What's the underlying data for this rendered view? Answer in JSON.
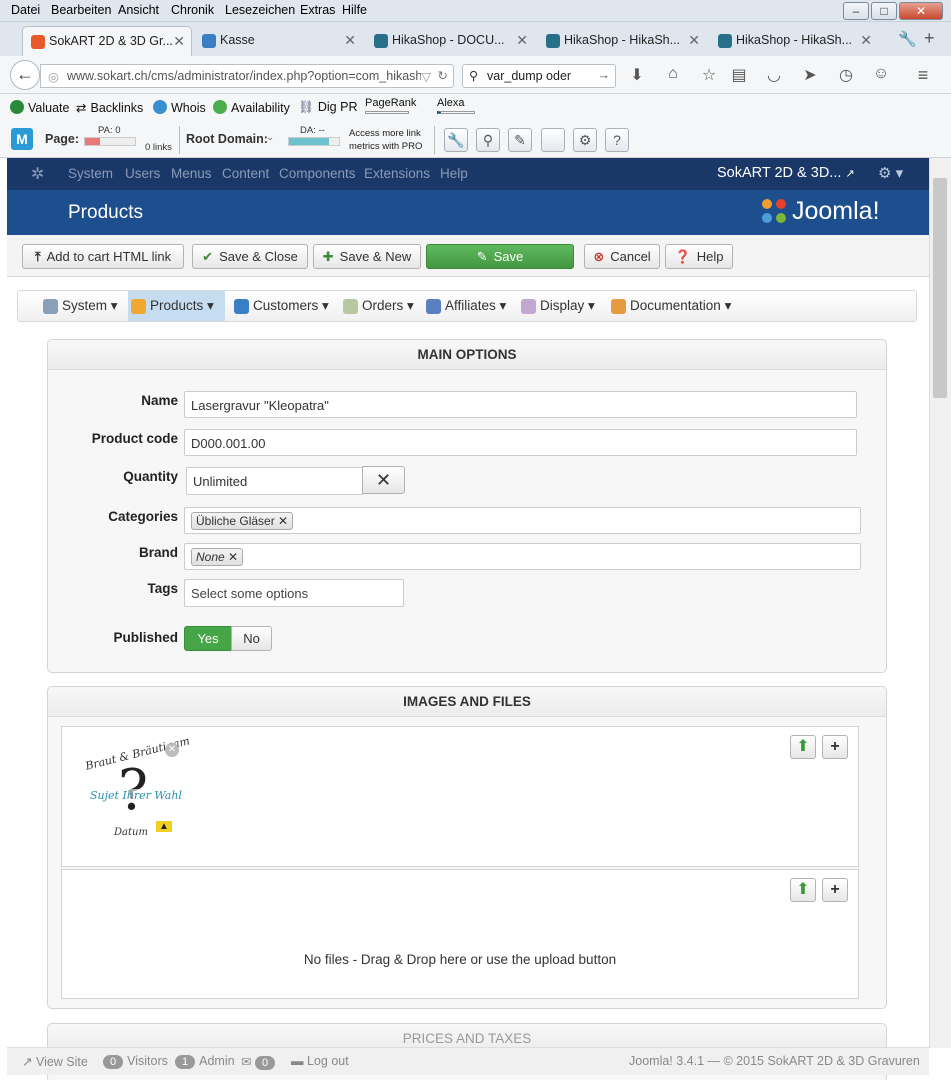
{
  "menubar": {
    "items": [
      "Datei",
      "Bearbeiten",
      "Ansicht",
      "Chronik",
      "Lesezeichen",
      "Extras",
      "Hilfe"
    ]
  },
  "tabs": [
    {
      "label": "SokART 2D & 3D Gr..."
    },
    {
      "label": "Kasse"
    },
    {
      "label": "HikaShop - DOCU..."
    },
    {
      "label": "HikaShop - HikaSh..."
    },
    {
      "label": "HikaShop - HikaSh..."
    }
  ],
  "nav": {
    "url": "www.sokart.ch/cms/administrator/index.php?option=com_hikash",
    "search": "var_dump oder"
  },
  "seo": {
    "row1": [
      "Valuate",
      "Backlinks",
      "Whois",
      "Availability",
      "Dig PR",
      "PageRank",
      "Alexa"
    ],
    "page_label": "Page:",
    "pa": "PA: 0",
    "links": "0 links",
    "root_label": "Root Domain:",
    "da": "DA: --",
    "access": "Access more link",
    "access2": "metrics with PRO"
  },
  "joomla": {
    "menu": [
      "System",
      "Users",
      "Menus",
      "Content",
      "Components",
      "Extensions",
      "Help"
    ],
    "site": "SokART 2D & 3D...",
    "page_title": "Products",
    "logo": "Joomla!"
  },
  "toolbar": {
    "add_cart": "Add to cart HTML link",
    "save_close": "Save & Close",
    "save_new": "Save & New",
    "save": "Save",
    "cancel": "Cancel",
    "help": "Help"
  },
  "hikamenu": [
    "System",
    "Products",
    "Customers",
    "Orders",
    "Affiliates",
    "Display",
    "Documentation"
  ],
  "main": {
    "title": "MAIN OPTIONS",
    "name_label": "Name",
    "name": "Lasergravur \"Kleopatra\"",
    "code_label": "Product code",
    "code": "D000.001.00",
    "qty_label": "Quantity",
    "qty": "Unlimited",
    "cat_label": "Categories",
    "cat": "Übliche Gläser",
    "brand_label": "Brand",
    "brand": "None",
    "tags_label": "Tags",
    "tags_ph": "Select some options",
    "pub_label": "Published",
    "yes": "Yes",
    "no": "No"
  },
  "images": {
    "title": "IMAGES AND FILES",
    "img_t1": "Braut & Bräutigam",
    "img_t2": "Sujet Ihrer Wahl",
    "img_t3": "Datum",
    "nofiles": "No files - Drag & Drop here or use the upload button"
  },
  "prices": {
    "title": "PRICES AND TAXES"
  },
  "footer": {
    "view": "View Site",
    "visitors_n": "0",
    "visitors": "Visitors",
    "admin_n": "1",
    "admin": "Admin",
    "msg_n": "0",
    "logout": "Log out",
    "copy": "Joomla! 3.4.1  —  © 2015 SokART 2D & 3D Gravuren"
  }
}
